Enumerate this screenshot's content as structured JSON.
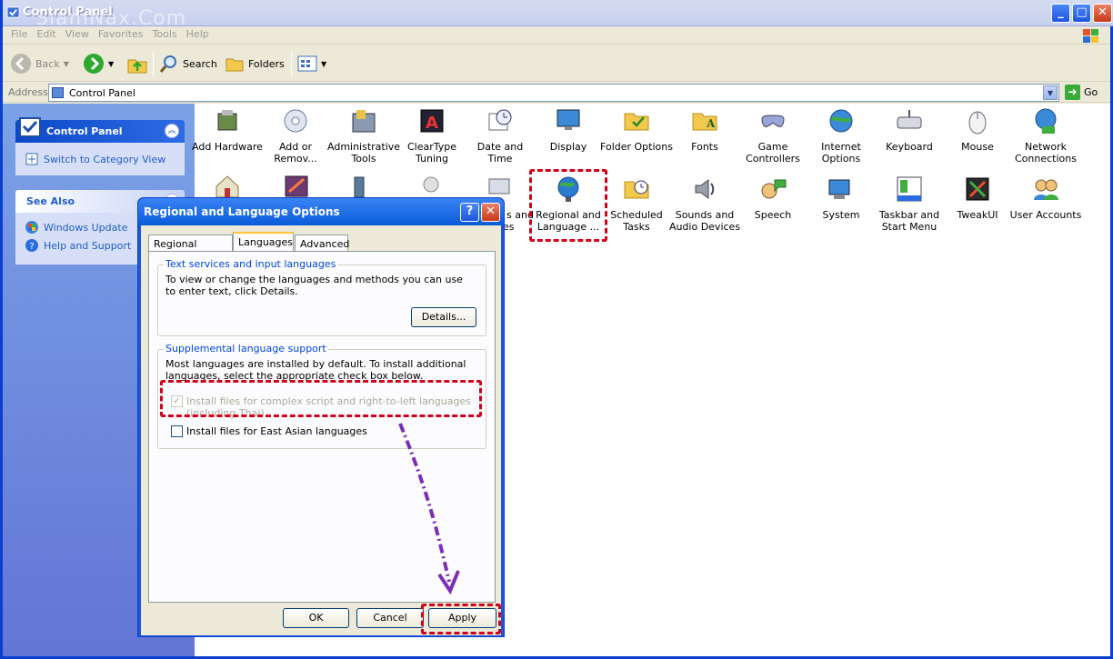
{
  "window": {
    "title": "Control Panel",
    "watermark": "SiamNax.Com"
  },
  "menu": [
    "File",
    "Edit",
    "View",
    "Favorites",
    "Tools",
    "Help"
  ],
  "toolbar": {
    "back": "Back",
    "search": "Search",
    "folders": "Folders"
  },
  "address": {
    "label": "Address",
    "value": "Control Panel",
    "go": "Go"
  },
  "sidebar": {
    "control_panel": {
      "title": "Control Panel",
      "link": "Switch to Category View"
    },
    "see_also": {
      "title": "See Also",
      "links": [
        "Windows Update",
        "Help and Support"
      ]
    }
  },
  "items": [
    {
      "label": "Add Hardware",
      "icon": "add-hardware-icon"
    },
    {
      "label": "Add or Remov...",
      "icon": "add-remove-programs-icon"
    },
    {
      "label": "Administrative Tools",
      "icon": "administrative-tools-icon"
    },
    {
      "label": "ClearType Tuning",
      "icon": "cleartype-icon"
    },
    {
      "label": "Date and Time",
      "icon": "date-time-icon"
    },
    {
      "label": "Display",
      "icon": "display-icon"
    },
    {
      "label": "Folder Options",
      "icon": "folder-options-icon"
    },
    {
      "label": "Fonts",
      "icon": "fonts-icon"
    },
    {
      "label": "Game Controllers",
      "icon": "game-controllers-icon"
    },
    {
      "label": "Internet Options",
      "icon": "internet-options-icon"
    },
    {
      "label": "Keyboard",
      "icon": "keyboard-icon"
    },
    {
      "label": "Mouse",
      "icon": "mouse-icon"
    },
    {
      "label": "Network Connections",
      "icon": "network-connections-icon"
    },
    {
      "label": "Regional and Language ...",
      "icon": "regional-language-icon"
    },
    {
      "label": "Scheduled Tasks",
      "icon": "scheduled-tasks-icon"
    },
    {
      "label": "Sounds and Audio Devices",
      "icon": "sounds-icon"
    },
    {
      "label": "Speech",
      "icon": "speech-icon"
    },
    {
      "label": "System",
      "icon": "system-icon"
    },
    {
      "label": "Taskbar and Start Menu",
      "icon": "taskbar-icon"
    },
    {
      "label": "TweakUI",
      "icon": "tweakui-icon"
    },
    {
      "label": "User Accounts",
      "icon": "user-accounts-icon"
    }
  ],
  "partial_items": [
    "s and",
    "es"
  ],
  "dialog": {
    "title": "Regional and Language Options",
    "tabs": [
      "Regional Options",
      "Languages",
      "Advanced"
    ],
    "active_tab": "Languages",
    "text_services": {
      "legend": "Text services and input languages",
      "text": "To view or change the languages and methods you can use to enter text, click Details.",
      "details": "Details..."
    },
    "supplemental": {
      "legend": "Supplemental language support",
      "text": "Most languages are installed by default. To install additional languages, select the appropriate check box below.",
      "complex": "Install files for complex script and right-to-left languages (including Thai)",
      "complex_checked": true,
      "east_asian": "Install files for East Asian languages",
      "east_asian_checked": false
    },
    "buttons": {
      "ok": "OK",
      "cancel": "Cancel",
      "apply": "Apply"
    }
  },
  "colors": {
    "highlight": "#d0021b",
    "arrow": "#7b2fb5",
    "xp_blue": "#0a5bd9"
  }
}
